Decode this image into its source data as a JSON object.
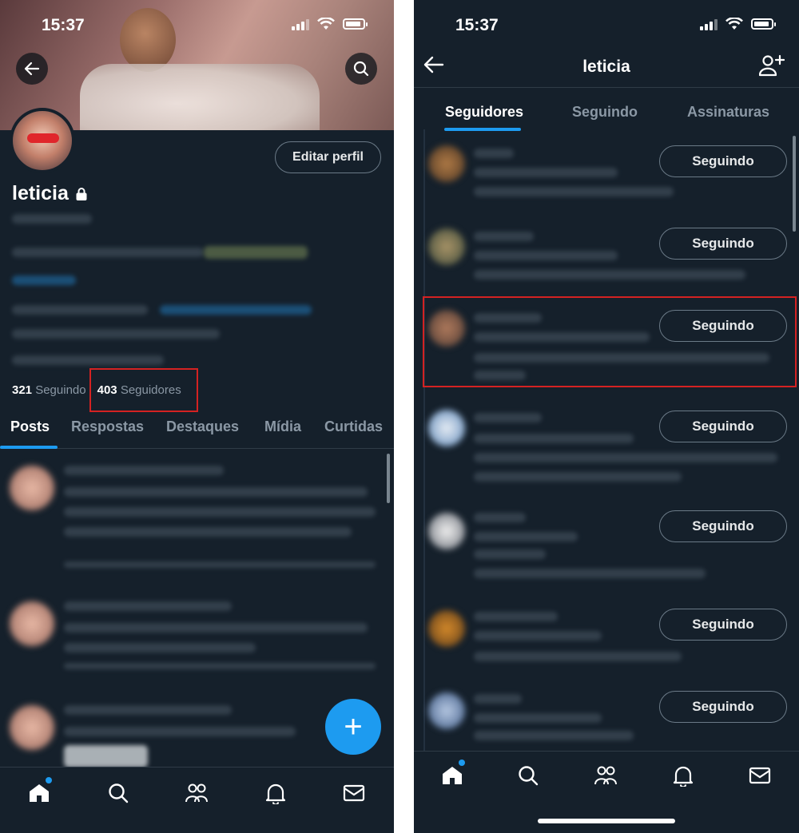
{
  "left": {
    "status": {
      "time": "15:37"
    },
    "profile": {
      "name": "leticia",
      "edit_button": "Editar perfil",
      "following_count": "321",
      "following_label": "Seguindo",
      "followers_count": "403",
      "followers_label": "Seguidores"
    },
    "tabs": [
      "Posts",
      "Respostas",
      "Destaques",
      "Mídia",
      "Curtidas"
    ],
    "fab_label": "+",
    "nav_icons": [
      "home-icon",
      "search-icon",
      "communities-icon",
      "bell-icon",
      "mail-icon"
    ]
  },
  "right": {
    "status": {
      "time": "15:37"
    },
    "header": {
      "title": "leticia"
    },
    "tabs": [
      "Seguidores",
      "Seguindo",
      "Assinaturas"
    ],
    "followers": [
      {
        "button": "Seguindo"
      },
      {
        "button": "Seguindo"
      },
      {
        "button": "Seguindo"
      },
      {
        "button": "Seguindo"
      },
      {
        "button": "Seguindo"
      },
      {
        "button": "Seguindo"
      },
      {
        "button": "Seguindo"
      }
    ],
    "nav_icons": [
      "home-icon",
      "search-icon",
      "communities-icon",
      "bell-icon",
      "mail-icon"
    ]
  },
  "colors": {
    "background": "#15202b",
    "accent": "#1d9bf0",
    "highlight_box": "#d42222",
    "muted_text": "#8b98a5"
  }
}
